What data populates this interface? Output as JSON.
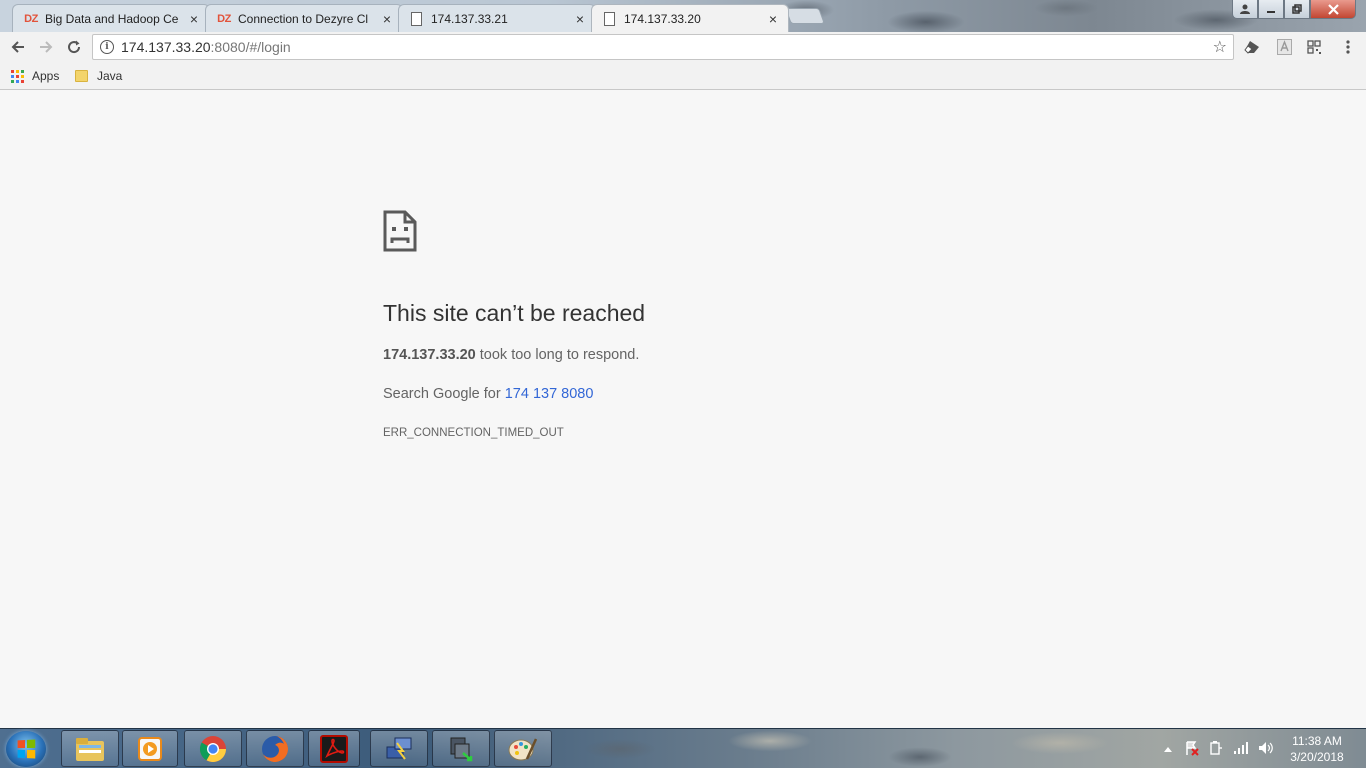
{
  "tabs": [
    {
      "label": "Big Data and Hadoop Ce",
      "favicon": "DZ",
      "active": false
    },
    {
      "label": "Connection to Dezyre Cl",
      "favicon": "DZ",
      "active": false
    },
    {
      "label": "174.137.33.21",
      "favicon": "page-icon",
      "active": false
    },
    {
      "label": "174.137.33.20",
      "favicon": "page-icon",
      "active": true
    }
  ],
  "address": {
    "host": "174.137.33.20",
    "path": ":8080/#/login"
  },
  "bookmarks": {
    "apps": "Apps",
    "java": "Java"
  },
  "error": {
    "title": "This site can’t be reached",
    "host": "174.137.33.20",
    "message": " took too long to respond.",
    "search_prefix": "Search Google for ",
    "search_link": "174 137 8080",
    "code": "ERR_CONNECTION_TIMED_OUT"
  },
  "clock": {
    "time": "11:38 AM",
    "date": "3/20/2018"
  },
  "colors": {
    "link": "#3367d6",
    "dz_brand": "#e2533b"
  }
}
